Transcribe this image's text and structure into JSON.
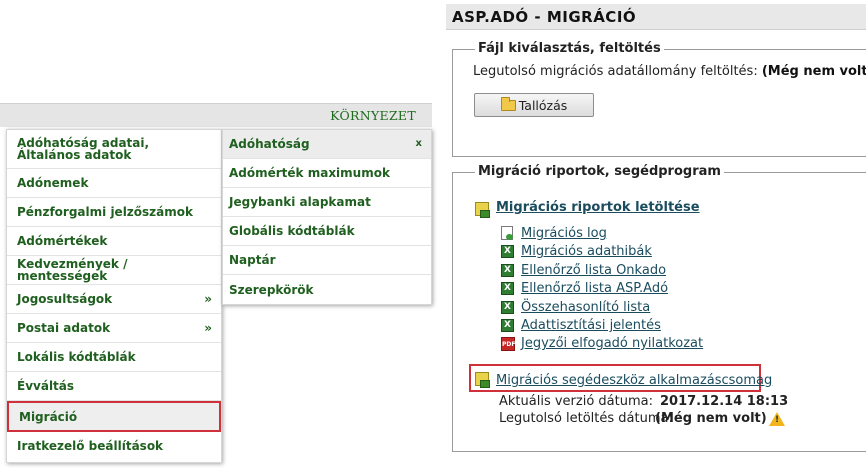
{
  "environment": {
    "title": "KÖRNYEZET"
  },
  "menu": {
    "items": [
      {
        "label": "Adóhatóság adatai, Általános adatok",
        "has_submenu": false
      },
      {
        "label": "Adónemek",
        "has_submenu": false
      },
      {
        "label": "Pénzforgalmi jelzőszámok",
        "has_submenu": false
      },
      {
        "label": "Adómértékek",
        "has_submenu": false
      },
      {
        "label": "Kedvezmények / mentességek",
        "has_submenu": false
      },
      {
        "label": "Jogosultságok",
        "has_submenu": true
      },
      {
        "label": "Postai adatok",
        "has_submenu": true
      },
      {
        "label": "Lokális kódtáblák",
        "has_submenu": false
      },
      {
        "label": "Évváltás",
        "has_submenu": false
      },
      {
        "label": "Migráció",
        "has_submenu": false,
        "selected": true
      },
      {
        "label": "Iratkezelő beállítások",
        "has_submenu": false
      }
    ],
    "submenu_arrow": "»",
    "submenu": {
      "close_label": "x",
      "items": [
        {
          "label": "Adóhatóság"
        },
        {
          "label": "Adómérték maximumok"
        },
        {
          "label": "Jegybanki alapkamat"
        },
        {
          "label": "Globális kódtáblák"
        },
        {
          "label": "Naptár"
        },
        {
          "label": "Szerepkörök"
        }
      ]
    }
  },
  "panel": {
    "title": "ASP.ADÓ - MIGRÁCIÓ",
    "upload_section": {
      "legend": "Fájl kiválasztás, feltöltés",
      "last_upload_label": "Legutolsó migrációs adatállomány feltöltés:",
      "last_upload_value": "(Még nem volt)",
      "browse_label": "Tallózás"
    },
    "reports_section": {
      "legend": "Migráció riportok, segédprogram",
      "download_link": "Migrációs riportok letöltése",
      "reports": [
        {
          "label": "Migrációs log",
          "icon": "log-icon"
        },
        {
          "label": "Migrációs adathibák",
          "icon": "xls-icon"
        },
        {
          "label": "Ellenőrző lista Onkado",
          "icon": "xls-icon"
        },
        {
          "label": "Ellenőrző lista ASP.Adó",
          "icon": "xls-icon"
        },
        {
          "label": "Összehasonlító lista",
          "icon": "xls-icon"
        },
        {
          "label": "Adattisztítási jelentés",
          "icon": "xls-icon"
        },
        {
          "label": "Jegyzői elfogadó nyilatkozat",
          "icon": "pdf-icon"
        }
      ],
      "tool_link": "Migrációs segédeszköz alkalmazáscsomag",
      "version_date_label": "Aktuális verzió dátuma:",
      "version_date_value": "2017.12.14 18:13",
      "last_download_label": "Legutolsó letöltés dátuma:",
      "last_download_value": "(Még nem volt)"
    }
  },
  "colors": {
    "menu_text": "#1f5f1f",
    "link": "#1a4c5e",
    "highlight": "#d0303a"
  }
}
